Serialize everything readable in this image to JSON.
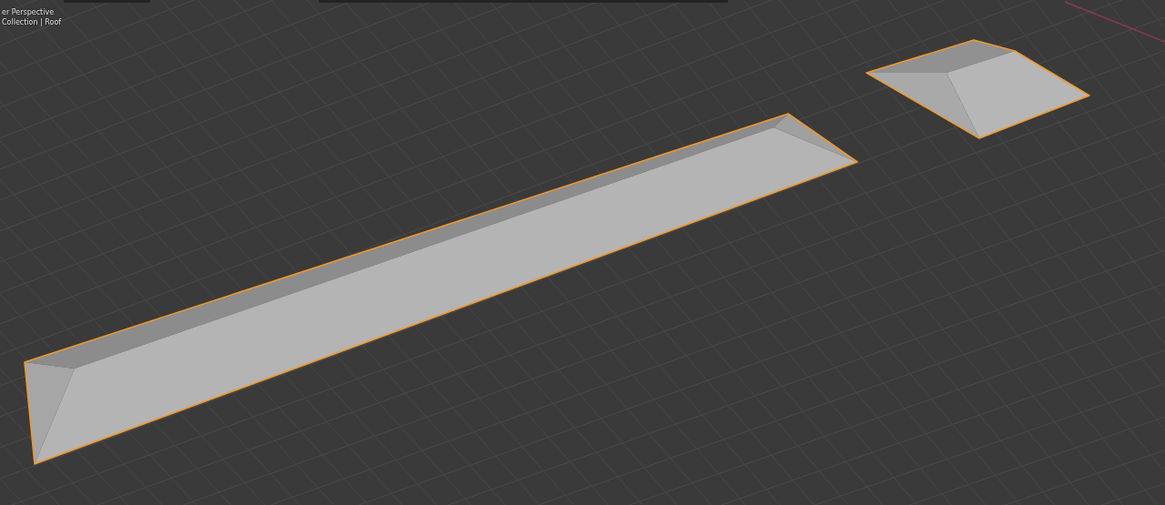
{
  "viewport": {
    "overlay_lines": [
      "er Perspective",
      "Collection | Roof"
    ],
    "objects": [
      {
        "kind": "long-roof",
        "selected": true
      },
      {
        "kind": "hip-roof",
        "selected": true
      }
    ]
  }
}
